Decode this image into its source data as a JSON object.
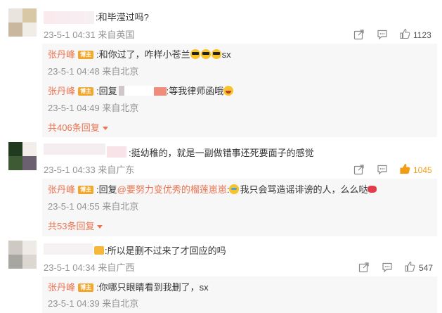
{
  "colors": {
    "accent": "#eb7350",
    "badge": "#f4a62a",
    "meta": "#939393",
    "like_active": "#f39c12",
    "reply_bg": "#f7f7f7"
  },
  "comments": [
    {
      "text": ":和毕滢过吗?",
      "time": "23-5-1 04:31",
      "location": "来自英国",
      "likes": "1123",
      "like_active": false,
      "replies": [
        {
          "name": "张丹峰",
          "badge": "博主",
          "text_pre": ":和你过了，咋样小苍兰",
          "text_post": "sx",
          "time": "23-5-1 04:48",
          "location": "来自北京"
        },
        {
          "name": "张丹峰",
          "badge": "博主",
          "text_pre": ":回复",
          "text_post": ":等我律师函哦",
          "time": "23-5-1 04:49",
          "location": "来自北京"
        }
      ],
      "more": "共406条回复"
    },
    {
      "text": ":挺幼稚的，就是一副做错事还死要面子的感觉",
      "time": "23-5-1 04:33",
      "location": "来自广东",
      "likes": "1045",
      "like_active": true,
      "replies": [
        {
          "name": "张丹峰",
          "badge": "博主",
          "text_pre": ":回复",
          "mention": "@要努力变优秀的榴莲崽崽",
          "text_post": ":",
          "text_post2": "我只会骂造谣诽谤的人，么么哒",
          "time": "23-5-1 04:55",
          "location": "来自北京"
        }
      ],
      "more": "共53条回复"
    },
    {
      "text": ":所以是删不过来了才回应的吗",
      "time": "23-5-1 04:34",
      "location": "来自广西",
      "likes": "547",
      "like_active": false,
      "replies": [
        {
          "name": "张丹峰",
          "badge": "博主",
          "text_pre": ":你哪只眼睛看到我删了，sx",
          "time": "23-5-1 04:39",
          "location": "来自北京"
        }
      ]
    }
  ],
  "icons": {
    "share": "share-icon",
    "comment": "comment-icon",
    "like": "thumbs-up-icon"
  }
}
